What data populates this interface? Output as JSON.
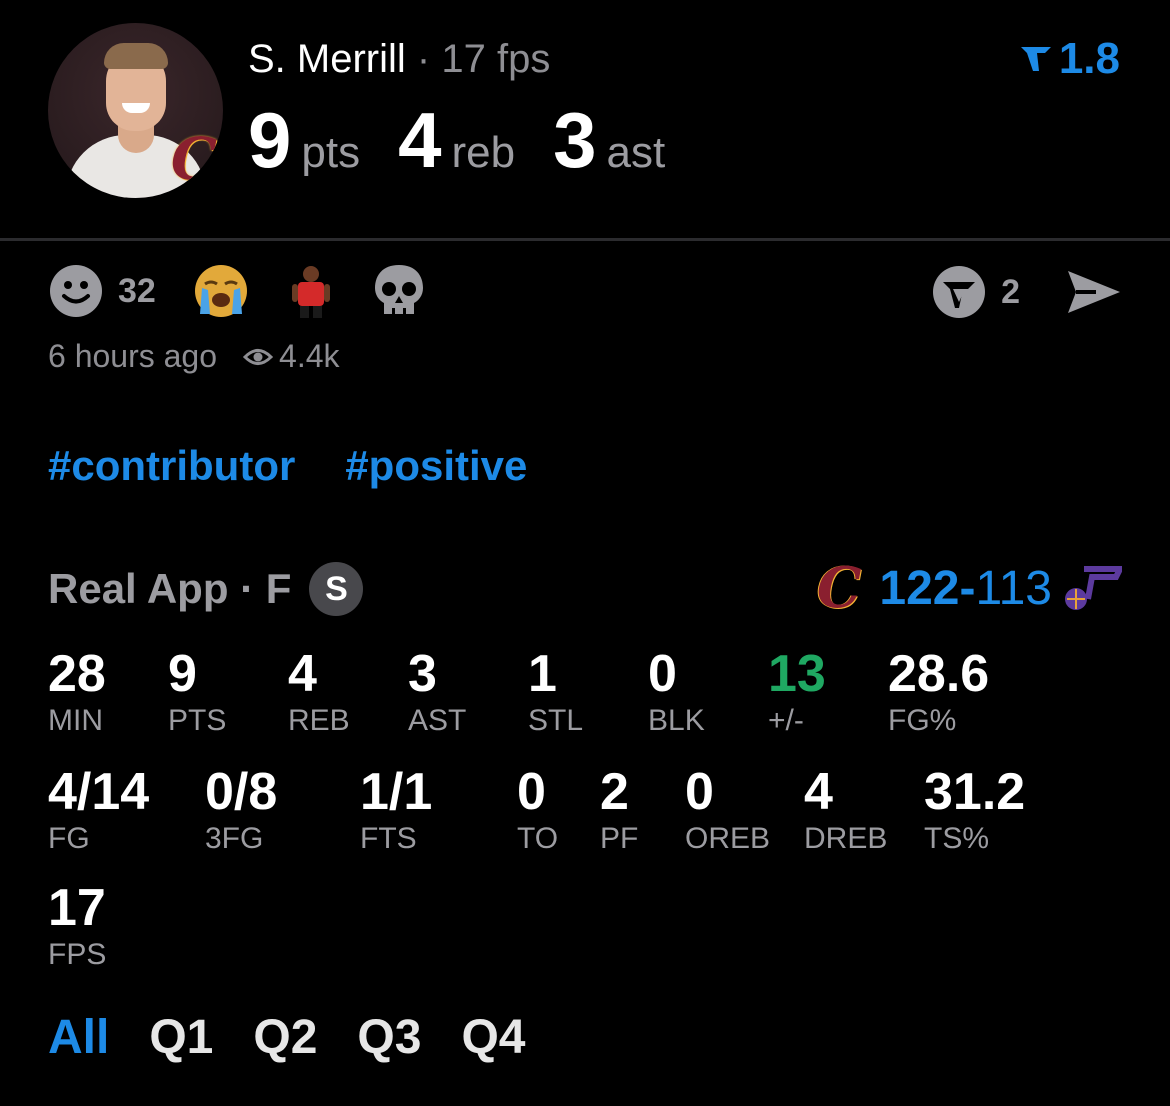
{
  "player": {
    "name": "S. Merrill",
    "separator": "·",
    "fps_label": "17 fps",
    "team_logo": "cavaliers-c-logo"
  },
  "headline_stats": [
    {
      "value": "9",
      "label": "pts"
    },
    {
      "value": "4",
      "label": "reb"
    },
    {
      "value": "3",
      "label": "ast"
    }
  ],
  "rating": {
    "icon": "rating-flag-icon",
    "value": "1.8",
    "color": "#1d8ae6"
  },
  "reactions": [
    {
      "icon": "smiley-face-icon",
      "count": "32"
    },
    {
      "icon": "crying-face-icon"
    },
    {
      "icon": "player-sticker-icon"
    },
    {
      "icon": "skull-icon"
    }
  ],
  "share": {
    "boost_icon": "boost-badge-icon",
    "boost_count": "2",
    "send_icon": "send-icon"
  },
  "meta": {
    "time": "6 hours ago",
    "views_icon": "eye-icon",
    "views": "4.4k"
  },
  "tags": [
    "#contributor",
    "#positive"
  ],
  "game": {
    "source": "Real App · F",
    "badge": "S",
    "home_logo": "cavaliers-c-logo",
    "home_score": "122",
    "dash": "-",
    "away_score": "113",
    "away_logo": "jazz-note-logo"
  },
  "stats_row1": [
    {
      "value": "28",
      "label": "MIN"
    },
    {
      "value": "9",
      "label": "PTS"
    },
    {
      "value": "4",
      "label": "REB"
    },
    {
      "value": "3",
      "label": "AST"
    },
    {
      "value": "1",
      "label": "STL"
    },
    {
      "value": "0",
      "label": "BLK"
    },
    {
      "value": "13",
      "label": "+/-"
    },
    {
      "value": "28.6",
      "label": "FG%"
    }
  ],
  "stats_row2": [
    {
      "value": "4/14",
      "label": "FG"
    },
    {
      "value": "0/8",
      "label": "3FG"
    },
    {
      "value": "1/1",
      "label": "FTS"
    },
    {
      "value": "0",
      "label": "TO"
    },
    {
      "value": "2",
      "label": "PF"
    },
    {
      "value": "0",
      "label": "OREB"
    },
    {
      "value": "4",
      "label": "DREB"
    },
    {
      "value": "31.2",
      "label": "TS%"
    }
  ],
  "stats_row3": [
    {
      "value": "17",
      "label": "FPS"
    }
  ],
  "period_tabs": [
    "All",
    "Q1",
    "Q2",
    "Q3",
    "Q4"
  ],
  "colors": {
    "accent": "#1d8ae6",
    "positive": "#1fa862",
    "muted": "#9c9ca1"
  }
}
